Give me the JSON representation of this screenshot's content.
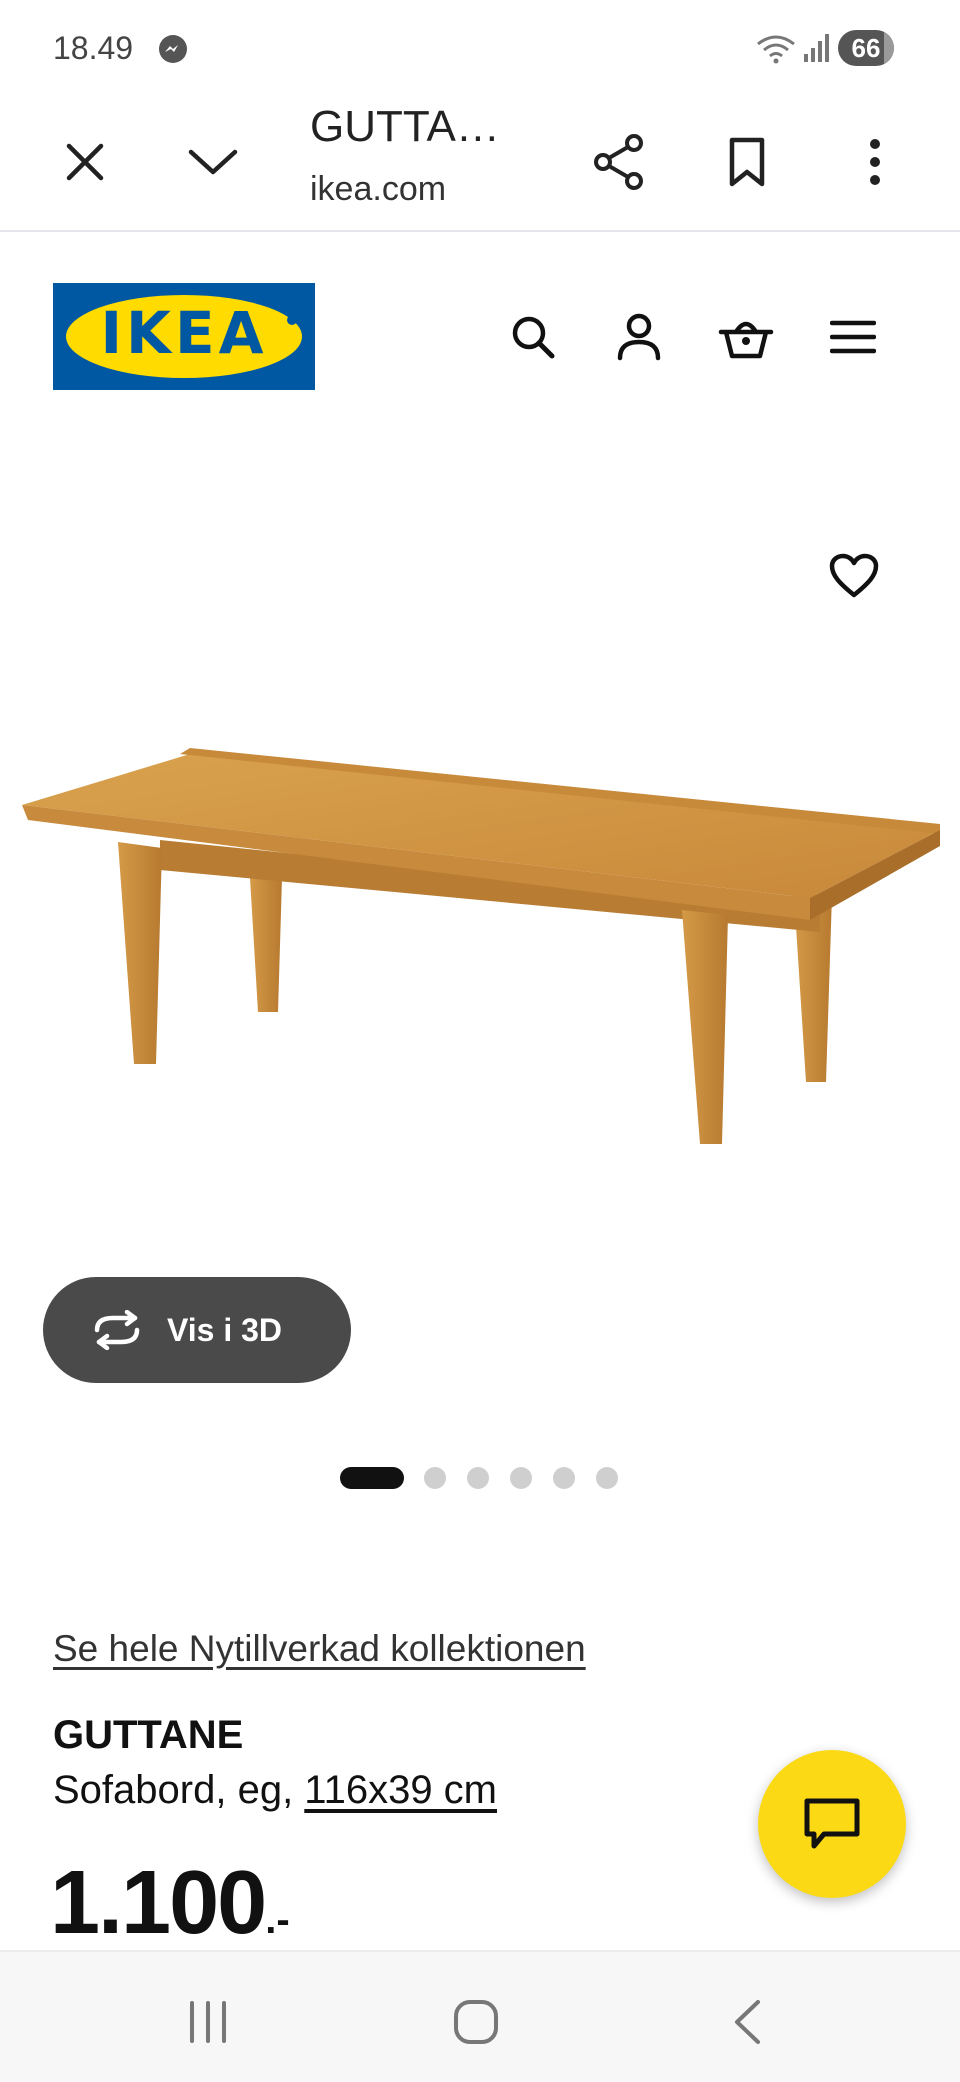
{
  "status_bar": {
    "time": "18.49",
    "battery": "66"
  },
  "browser": {
    "title": "GUTTA…",
    "url": "ikea.com"
  },
  "brand": {
    "logo_text": "IKEA",
    "logo_blue": "#0058a3",
    "logo_yellow": "#ffdb00"
  },
  "header": {
    "icons": [
      "search-icon",
      "account-icon",
      "basket-icon",
      "menu-icon"
    ]
  },
  "gallery": {
    "view_3d_label": "Vis i 3D",
    "image_count": 6,
    "active_index": 0
  },
  "product": {
    "collection_link": "Se hele Nytillverkad kollektionen",
    "name": "GUTTANE",
    "description": "Sofabord, eg, ",
    "size": "116x39 cm",
    "price": "1.100",
    "price_suffix": ".-"
  },
  "colors": {
    "chat_yellow": "#fbd914",
    "view3d_bg": "#4a4a4a"
  }
}
